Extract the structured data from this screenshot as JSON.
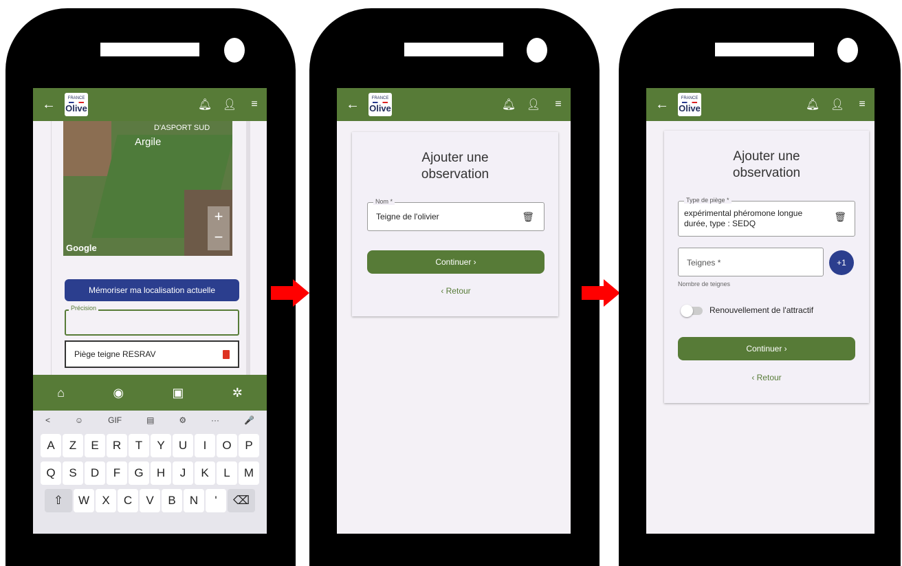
{
  "appbar": {
    "back_icon": "arrow-left-icon",
    "logo_top": "FRANCE",
    "logo_main": "Olive",
    "icons": [
      "bell-icon",
      "user-icon",
      "menu-icon"
    ]
  },
  "screen1": {
    "map": {
      "label_area": "D'ASPORT SUD",
      "label_soil": "Argile",
      "attribution": "Google",
      "zoom_in": "+",
      "zoom_out": "−"
    },
    "memorize_button": "Mémoriser ma localisation actuelle",
    "precision_label": "Précision",
    "precision_value": "",
    "trap_item": "Piège teigne RESRAV",
    "bottom_nav": [
      "home-icon",
      "eye-plus-icon",
      "calendar-plus-icon",
      "tree-icon"
    ],
    "keyboard": {
      "toolbar": [
        "<",
        "☺",
        "GIF",
        "▤",
        "⚙",
        "···",
        "🎤"
      ],
      "row1": [
        "A",
        "Z",
        "E",
        "R",
        "T",
        "Y",
        "U",
        "I",
        "O",
        "P"
      ],
      "row2": [
        "Q",
        "S",
        "D",
        "F",
        "G",
        "H",
        "J",
        "K",
        "L",
        "M"
      ],
      "row3": [
        "⇧",
        "W",
        "X",
        "C",
        "V",
        "B",
        "N",
        "'",
        "⌫"
      ]
    }
  },
  "screen2": {
    "title": "Ajouter une observation",
    "name_label": "Nom *",
    "name_value": "Teigne de l'olivier",
    "continue_label": "Continuer  ›",
    "back_label": "‹  Retour"
  },
  "screen3": {
    "title": "Ajouter une observation",
    "trap_type_label": "Type de piège *",
    "trap_type_value": "expérimental phéromone longue durée, type : SEDQ",
    "teignes_placeholder": "Teignes *",
    "plus_one": "+1",
    "helper": "Nombre de teignes",
    "toggle_label": "Renouvellement de l'attractif",
    "continue_label": "Continuer  ›",
    "back_label": "‹  Retour"
  },
  "colors": {
    "brand_green": "#577b37",
    "brand_blue": "#2b3e8e",
    "arrow_red": "#ff0000"
  }
}
